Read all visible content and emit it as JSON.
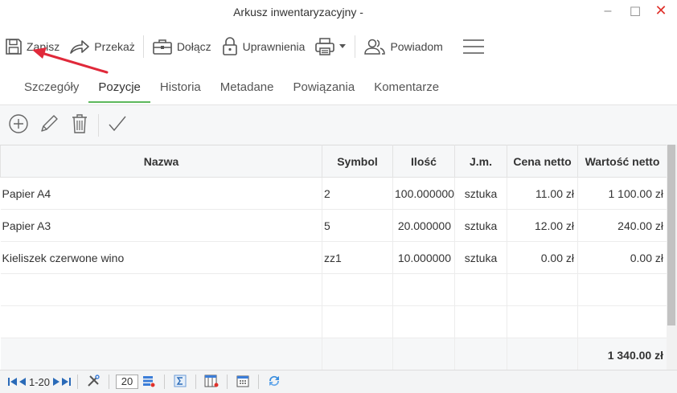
{
  "window": {
    "title": "Arkusz inwentaryzacyjny -",
    "min": "–",
    "max": "☐",
    "close": "✕"
  },
  "toolbar": {
    "save": "Zapisz",
    "forward": "Przekaż",
    "attach": "Dołącz",
    "permissions": "Uprawnienia",
    "notify": "Powiadom"
  },
  "tabs": [
    "Szczegóły",
    "Pozycje",
    "Historia",
    "Metadane",
    "Powiązania",
    "Komentarze"
  ],
  "active_tab": "Pozycje",
  "columns": [
    "Nazwa",
    "Symbol",
    "Ilość",
    "J.m.",
    "Cena netto",
    "Wartość netto"
  ],
  "rows": [
    {
      "name": "Papier A4",
      "symbol": "2",
      "qty": "100.000000",
      "unit": "sztuka",
      "price": "11.00 zł",
      "value": "1 100.00 zł"
    },
    {
      "name": "Papier A3",
      "symbol": "5",
      "qty": "20.000000",
      "unit": "sztuka",
      "price": "12.00 zł",
      "value": "240.00 zł"
    },
    {
      "name": "Kieliszek czerwone wino",
      "symbol": "zz1",
      "qty": "10.000000",
      "unit": "sztuka",
      "price": "0.00 zł",
      "value": "0.00 zł"
    }
  ],
  "total": "1 340.00 zł",
  "pager": {
    "range": "1-20",
    "page_size": "20"
  },
  "colors": {
    "accent_green": "#5cb85c",
    "annotation_arrow": "#e0293a",
    "pager_blue": "#2a6ab8"
  }
}
